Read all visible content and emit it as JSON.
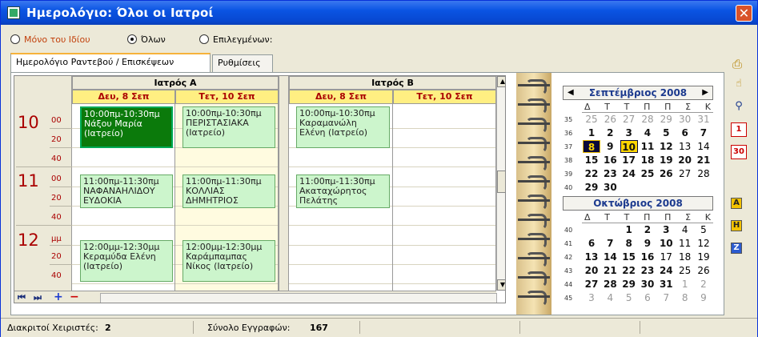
{
  "window": {
    "title": "Ημερολόγιο: Όλοι οι Ιατροί",
    "close": "✕"
  },
  "filter": {
    "options": [
      {
        "label": "Μόνο του Ιδίου",
        "selected": false
      },
      {
        "label": "Όλων",
        "selected": true
      },
      {
        "label": "Επιλεγμένων:",
        "selected": false
      }
    ]
  },
  "tabs": [
    "Ημερολόγιο Ραντεβού / Επισκέψεων",
    "Ρυθμίσεις"
  ],
  "calendar": {
    "doctors": [
      "Ιατρός Α",
      "Ιατρός Β"
    ],
    "days": [
      "Δευ, 8 Σεπ",
      "Τετ, 10 Σεπ",
      "Δευ, 8 Σεπ",
      "Τετ, 10 Σεπ"
    ],
    "hours": [
      "10",
      "11",
      "12"
    ],
    "minute_labels": [
      "00",
      "20",
      "40",
      "00",
      "20",
      "40",
      "μμ",
      "20",
      "40"
    ],
    "appointments": [
      {
        "text": "10:00πμ-10:30πμ\nΝάξου Μαρία\n(Ιατρείο)",
        "selected": true
      },
      {
        "text": "10:00πμ-10:30πμ\nΠΕΡΙΣΤΑΣΙΑΚΑ\n(Ιατρείο)",
        "selected": false
      },
      {
        "text": "10:00πμ-10:30πμ\nΚαραμανώλη\nΕλένη (Ιατρείο)",
        "selected": false
      },
      {
        "text": "11:00πμ-11:30πμ\nΝΑΦΑΝΑΗΛΙΔΟΥ\nΕΥΔΟΚΙΑ",
        "selected": false
      },
      {
        "text": "11:00πμ-11:30πμ\nΚΟΛΛΙΑΣ\nΔΗΜΗΤΡΙΟΣ",
        "selected": false
      },
      {
        "text": "11:00πμ-11:30πμ\nΑκαταχώρητος\nΠελάτης",
        "selected": false
      },
      {
        "text": "12:00μμ-12:30μμ\nΚεραμύδα Ελένη\n(Ιατρείο)",
        "selected": false
      },
      {
        "text": "12:00μμ-12:30μμ\nΚαράμπαμπας\nΝίκος (Ιατρείο)",
        "selected": false
      }
    ],
    "nav": {
      "first": "⏮",
      "last": "⏭",
      "add": "+",
      "remove": "−"
    }
  },
  "mini_calendar": {
    "weekday_headers": [
      "Δ",
      "Τ",
      "Τ",
      "Π",
      "Π",
      "Σ",
      "Κ"
    ],
    "months": [
      {
        "title": "Σεπτέμβριος 2008",
        "weeks": [
          {
            "no": "35",
            "days": [
              "25",
              "26",
              "27",
              "28",
              "29",
              "30",
              "31"
            ]
          },
          {
            "no": "36",
            "days": [
              "1",
              "2",
              "3",
              "4",
              "5",
              "6",
              "7"
            ]
          },
          {
            "no": "37",
            "days": [
              "8",
              "9",
              "10",
              "11",
              "12",
              "13",
              "14"
            ]
          },
          {
            "no": "38",
            "days": [
              "15",
              "16",
              "17",
              "18",
              "19",
              "20",
              "21"
            ]
          },
          {
            "no": "39",
            "days": [
              "22",
              "23",
              "24",
              "25",
              "26",
              "27",
              "28"
            ]
          },
          {
            "no": "40",
            "days": [
              "29",
              "30",
              "",
              "",
              "",
              "",
              ""
            ]
          }
        ]
      },
      {
        "title": "Οκτώβριος 2008",
        "weeks": [
          {
            "no": "40",
            "days": [
              "",
              "",
              "1",
              "2",
              "3",
              "4",
              "5"
            ]
          },
          {
            "no": "41",
            "days": [
              "6",
              "7",
              "8",
              "9",
              "10",
              "11",
              "12"
            ]
          },
          {
            "no": "42",
            "days": [
              "13",
              "14",
              "15",
              "16",
              "17",
              "18",
              "19"
            ]
          },
          {
            "no": "43",
            "days": [
              "20",
              "21",
              "22",
              "23",
              "24",
              "25",
              "26"
            ]
          },
          {
            "no": "44",
            "days": [
              "27",
              "28",
              "29",
              "30",
              "31",
              "1",
              "2"
            ]
          },
          {
            "no": "45",
            "days": [
              "3",
              "4",
              "5",
              "6",
              "7",
              "8",
              "9"
            ]
          }
        ]
      }
    ]
  },
  "side_tools": [
    {
      "icon": "print-icon",
      "glyph": "🖨"
    },
    {
      "icon": "hand-icon",
      "glyph": "☝"
    },
    {
      "icon": "zoom-icon",
      "glyph": "🔍"
    },
    {
      "icon": "day-view-icon",
      "glyph": "1"
    },
    {
      "icon": "month-view-icon",
      "glyph": "30"
    },
    {
      "icon": "a-icon",
      "glyph": "A"
    },
    {
      "icon": "h-icon",
      "glyph": "H"
    },
    {
      "icon": "z-icon",
      "glyph": "Z"
    }
  ],
  "status": {
    "users_label": "Διακριτοί Χειριστές:",
    "users_value": "2",
    "records_label": "Σύνολο Εγγραφών:",
    "records_value": "167"
  }
}
